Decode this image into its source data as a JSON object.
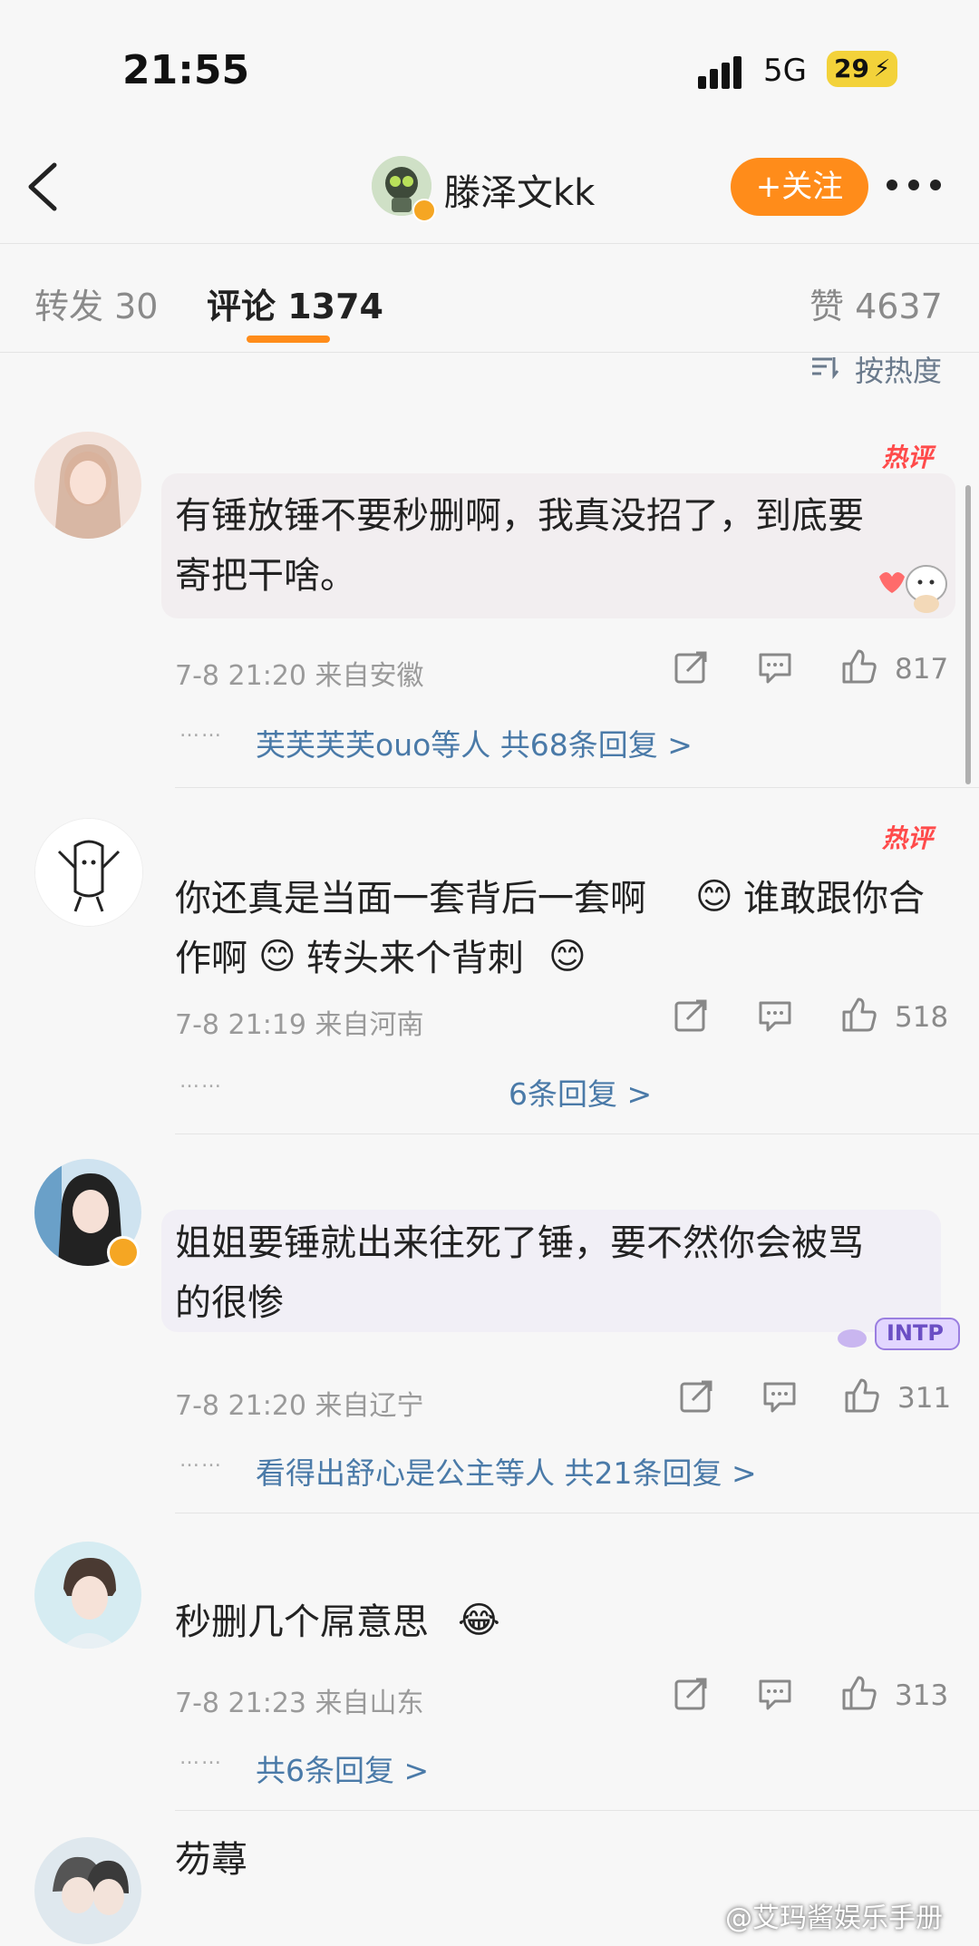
{
  "status_bar": {
    "time": "21:55",
    "network": "5G",
    "battery": "29"
  },
  "nav": {
    "nickname": "滕泽文kk",
    "follow_label": "+关注"
  },
  "tabs": {
    "repost": "转发 30",
    "comments": "评论 1374",
    "likes": "赞 4637",
    "sort": "按热度"
  },
  "comments": [
    {
      "hot": "热评",
      "text_line1": "有锤放锤不要秒删啊，我真没招了，到底要",
      "text_line2": "寄把干啥。",
      "meta": "7-8 21:20  来自安徽",
      "likes": "817",
      "replies": "芙芙芙芙ouo等人  共68条回复 >"
    },
    {
      "hot": "热评",
      "text_line1": "你还真是当面一套背后一套啊",
      "text_line1b": "谁敢跟你合",
      "text_line2a": "作啊",
      "text_line2b": "转头来个背刺",
      "meta": "7-8 21:19  来自河南",
      "likes": "518",
      "replies": "6条回复 >"
    },
    {
      "text_line1": "姐姐要锤就出来往死了锤，要不然你会被骂",
      "text_line2": "的很惨",
      "sticker": "INTP",
      "meta": "7-8 21:20  来自辽宁",
      "likes": "311",
      "replies": "看得出舒心是公主等人  共21条回复 >"
    },
    {
      "text_line1": "秒删几个屌意思",
      "meta": "7-8 21:23  来自山东",
      "likes": "313",
      "replies": "共6条回复 >"
    },
    {
      "text_line1": "芴蕁"
    }
  ],
  "dots": "……",
  "watermark": "@艾玛酱娱乐手册",
  "colors": {
    "accent": "#ff8c1a",
    "hot": "#ff4b4b",
    "link": "#4a7aa8"
  }
}
